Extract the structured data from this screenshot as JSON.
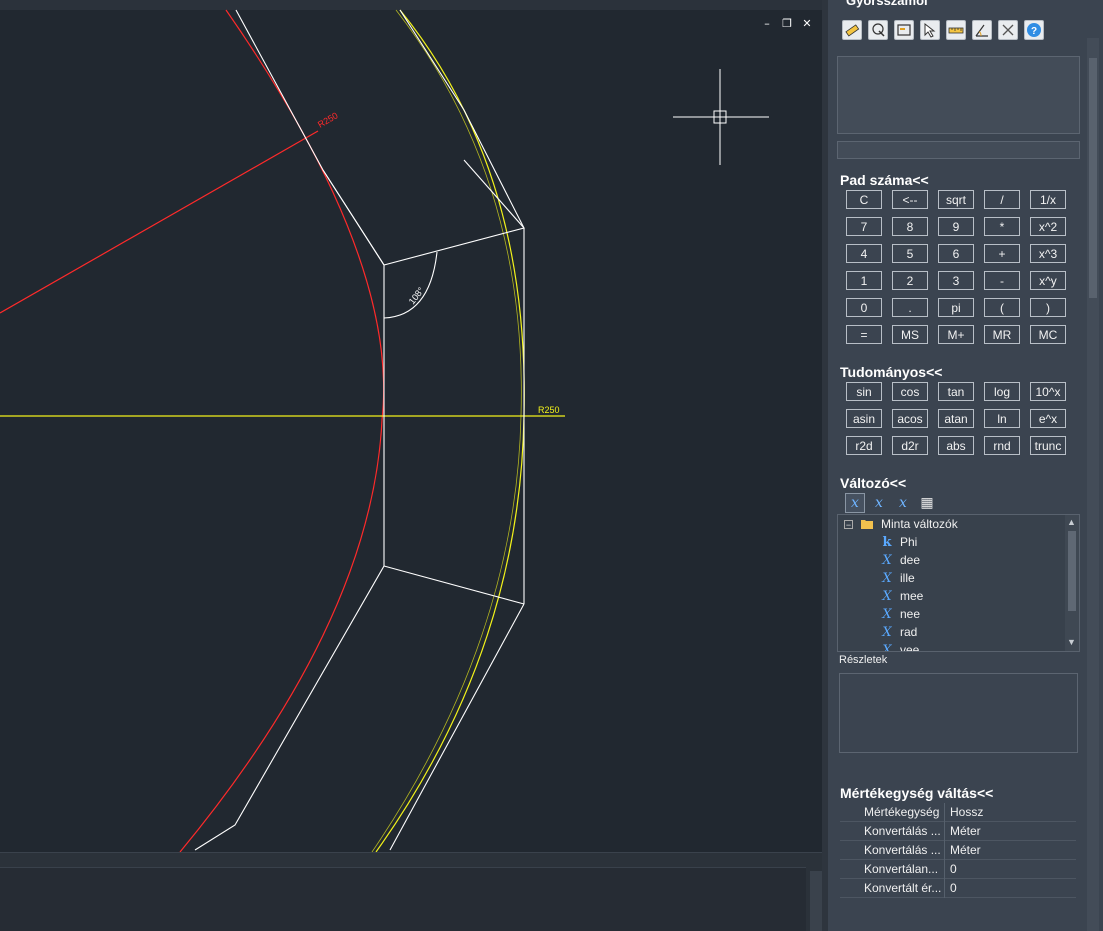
{
  "panel": {
    "title": "Gyorsszámol"
  },
  "drawing": {
    "dim_red_label": "R250",
    "dim_yellow_label": "R250",
    "angle_label": "108°",
    "colors": {
      "red": "#ff2a2a",
      "yellow": "#f2f21a",
      "white": "#ffffff",
      "background": "#212830"
    }
  },
  "window_controls": [
    "–",
    "❐",
    "✕"
  ],
  "toolbar_icons": [
    "eraser-icon",
    "paste-icon",
    "display-icon",
    "select-point-icon",
    "measure-distance-icon",
    "measure-angle-icon",
    "clear-icon",
    "help-icon"
  ],
  "number_pad": {
    "title": "Pad száma<<",
    "rows": [
      [
        "C",
        "<--",
        "sqrt",
        "/",
        "1/x"
      ],
      [
        "7",
        "8",
        "9",
        "*",
        "x^2"
      ],
      [
        "4",
        "5",
        "6",
        "+",
        "x^3"
      ],
      [
        "1",
        "2",
        "3",
        "-",
        "x^y"
      ],
      [
        "0",
        ".",
        "pi",
        "(",
        ")"
      ],
      [
        "=",
        "MS",
        "M+",
        "MR",
        "MC"
      ]
    ]
  },
  "scientific": {
    "title": "Tudományos<<",
    "rows": [
      [
        "sin",
        "cos",
        "tan",
        "log",
        "10^x"
      ],
      [
        "asin",
        "acos",
        "atan",
        "ln",
        "e^x"
      ],
      [
        "r2d",
        "d2r",
        "abs",
        "rnd",
        "trunc"
      ]
    ]
  },
  "variables": {
    "title": "Változó<<",
    "folder": "Minta változók",
    "items": [
      {
        "type": "k",
        "name": "Phi"
      },
      {
        "type": "x",
        "name": "dee"
      },
      {
        "type": "x",
        "name": "ille"
      },
      {
        "type": "x",
        "name": "mee"
      },
      {
        "type": "x",
        "name": "nee"
      },
      {
        "type": "x",
        "name": "rad"
      },
      {
        "type": "x",
        "name": "vee"
      }
    ],
    "details_label": "Részletek"
  },
  "unit_conversion": {
    "title": "Mértékegység váltás<<",
    "rows": [
      {
        "key": "Mértékegység",
        "value": "Hossz"
      },
      {
        "key": "Konvertálás ...",
        "value": "Méter"
      },
      {
        "key": "Konvertálás ...",
        "value": "Méter"
      },
      {
        "key": "Konvertálan...",
        "value": "0"
      },
      {
        "key": "Konvertált ér...",
        "value": "0"
      }
    ]
  }
}
